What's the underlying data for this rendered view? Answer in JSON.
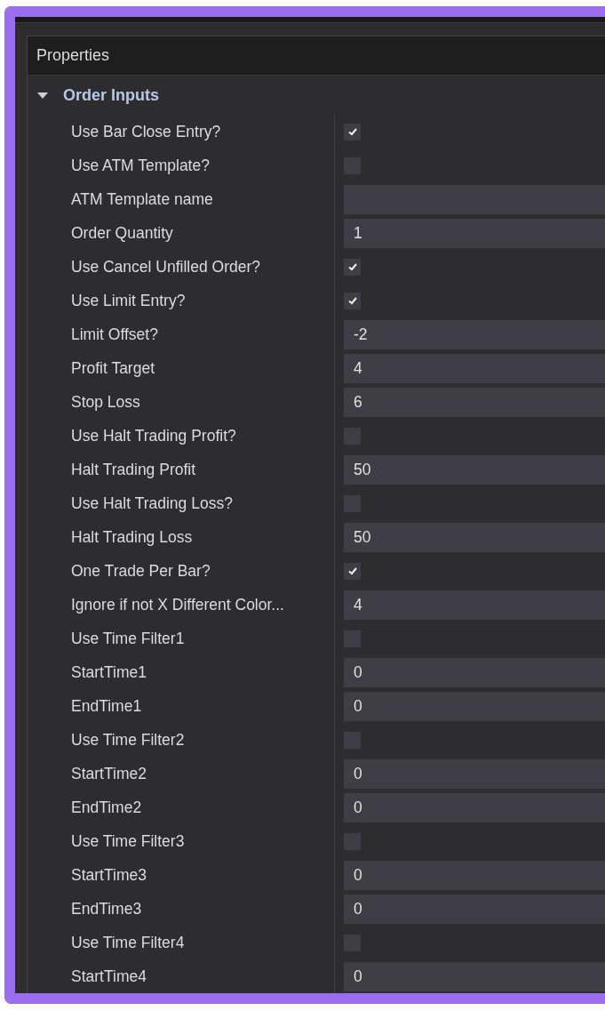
{
  "panel": {
    "title": "Properties"
  },
  "category": {
    "label": "Order Inputs",
    "expanded": true
  },
  "properties": [
    {
      "label": "Use Bar Close Entry?",
      "kind": "checkbox",
      "checked": true
    },
    {
      "label": "Use ATM Template?",
      "kind": "checkbox",
      "checked": false
    },
    {
      "label": "ATM Template name",
      "kind": "field"
    },
    {
      "label": "Order Quantity",
      "kind": "field",
      "value": "1"
    },
    {
      "label": "Use Cancel Unfilled Order?",
      "kind": "checkbox",
      "checked": true
    },
    {
      "label": "Use Limit Entry?",
      "kind": "checkbox",
      "checked": true
    },
    {
      "label": "Limit Offset?",
      "kind": "field",
      "value": "-2"
    },
    {
      "label": "Profit Target",
      "kind": "field",
      "value": "4"
    },
    {
      "label": "Stop Loss",
      "kind": "field",
      "value": "6"
    },
    {
      "label": "Use Halt Trading Profit?",
      "kind": "checkbox",
      "checked": false
    },
    {
      "label": "Halt Trading Profit",
      "kind": "field",
      "value": "50"
    },
    {
      "label": "Use Halt Trading Loss?",
      "kind": "checkbox",
      "checked": false
    },
    {
      "label": "Halt Trading Loss",
      "kind": "field",
      "value": "50"
    },
    {
      "label": "One Trade Per Bar?",
      "kind": "checkbox",
      "checked": true
    },
    {
      "label": "Ignore if not X Different Color...",
      "kind": "field",
      "value": "4"
    },
    {
      "label": "Use Time Filter1",
      "kind": "checkbox",
      "checked": false
    },
    {
      "label": "StartTime1",
      "kind": "field",
      "value": "0"
    },
    {
      "label": "EndTime1",
      "kind": "field",
      "value": "0"
    },
    {
      "label": "Use Time Filter2",
      "kind": "checkbox",
      "checked": false
    },
    {
      "label": "StartTime2",
      "kind": "field",
      "value": "0"
    },
    {
      "label": "EndTime2",
      "kind": "field",
      "value": "0"
    },
    {
      "label": "Use Time Filter3",
      "kind": "checkbox",
      "checked": false
    },
    {
      "label": "StartTime3",
      "kind": "field",
      "value": "0"
    },
    {
      "label": "EndTime3",
      "kind": "field",
      "value": "0"
    },
    {
      "label": "Use Time Filter4",
      "kind": "checkbox",
      "checked": false
    },
    {
      "label": "StartTime4",
      "kind": "field",
      "value": "0"
    }
  ]
}
